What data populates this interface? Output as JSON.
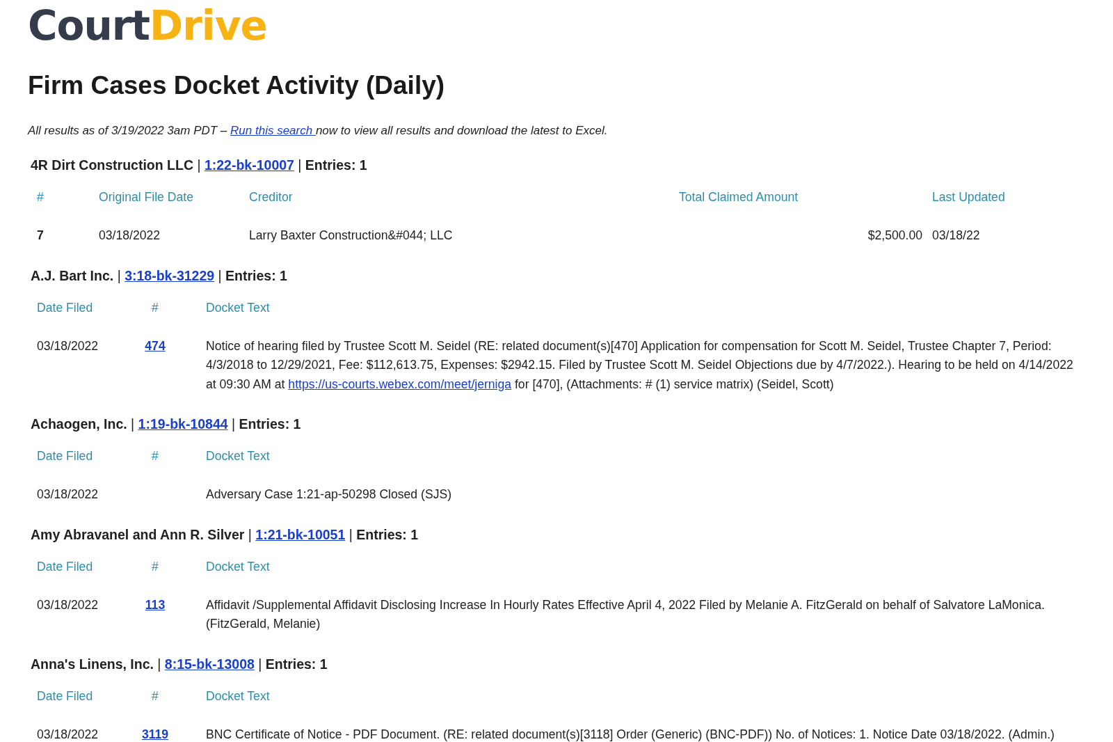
{
  "logo": {
    "first": "Court",
    "second": "Drive"
  },
  "title": "Firm Cases Docket Activity (Daily)",
  "intro": {
    "before": "All results as of 3/19/2022 3am PDT – ",
    "link": "Run this search ",
    "after": "now to view all results and download the latest to Excel."
  },
  "cases": [
    {
      "kind": "claims",
      "name": "4R Dirt Construction LLC",
      "separator": "|",
      "case_number": "1:22-bk-10007",
      "entries": "Entries: 1",
      "columns": [
        "#",
        "Original File Date",
        "Creditor",
        "Total Claimed Amount",
        "Last Updated"
      ],
      "rows": [
        {
          "number": "7",
          "date": "03/18/2022",
          "creditor": "Larry Baxter Construction&#044; LLC",
          "amount": "$2,500.00",
          "updated": "03/18/22"
        }
      ]
    },
    {
      "kind": "docket",
      "name": "A.J. Bart Inc.",
      "separator": "|",
      "case_number": "3:18-bk-31229",
      "entries": "Entries: 1",
      "columns": [
        "Date Filed",
        "#",
        "Docket Text"
      ],
      "rows": [
        {
          "date": "03/18/2022",
          "number": "474",
          "text": "Notice of hearing filed by Trustee Scott M. Seidel (RE: related document(s)[470] Application for compensation for Scott M. Seidel, Trustee Chapter 7, Period: 4/3/2018 to 12/29/2021, Fee: $112,613.75, Expenses: $2942.15. Filed by Trustee Scott M. Seidel Objections due by 4/7/2022.). Hearing to be held on 4/14/2022 at 09:30 AM at ",
          "link": "https://us-courts.webex.com/meet/jerniga",
          "text_after": " for [470], (Attachments: # (1) service matrix) (Seidel, Scott)"
        }
      ]
    },
    {
      "kind": "docket",
      "name": "Achaogen, Inc.",
      "separator": "|",
      "case_number": "1:19-bk-10844",
      "entries": "Entries: 1",
      "columns": [
        "Date Filed",
        "#",
        "Docket Text"
      ],
      "rows": [
        {
          "date": "03/18/2022",
          "text": "Adversary Case 1:21-ap-50298 Closed (SJS)"
        }
      ]
    },
    {
      "kind": "docket",
      "name": "Amy Abravanel and Ann R. Silver",
      "separator": "|",
      "case_number": "1:21-bk-10051",
      "entries": "Entries: 1",
      "columns": [
        "Date Filed",
        "#",
        "Docket Text"
      ],
      "rows": [
        {
          "date": "03/18/2022",
          "number": "113",
          "text": "Affidavit /Supplemental Affidavit Disclosing Increase In Hourly Rates Effective April 4, 2022 Filed by Melanie A. FitzGerald on behalf of Salvatore LaMonica. (FitzGerald, Melanie)"
        }
      ]
    },
    {
      "kind": "docket",
      "name": "Anna's Linens, Inc.",
      "separator": "|",
      "case_number": "8:15-bk-13008",
      "entries": "Entries: 1",
      "columns": [
        "Date Filed",
        "#",
        "Docket Text"
      ],
      "rows": [
        {
          "date": "03/18/2022",
          "number": "3119",
          "text": "BNC Certificate of Notice - PDF Document. (RE: related document(s)[3118] Order (Generic) (BNC-PDF)) No. of Notices: 1. Notice Date 03/18/2022. (Admin.)"
        }
      ]
    }
  ]
}
